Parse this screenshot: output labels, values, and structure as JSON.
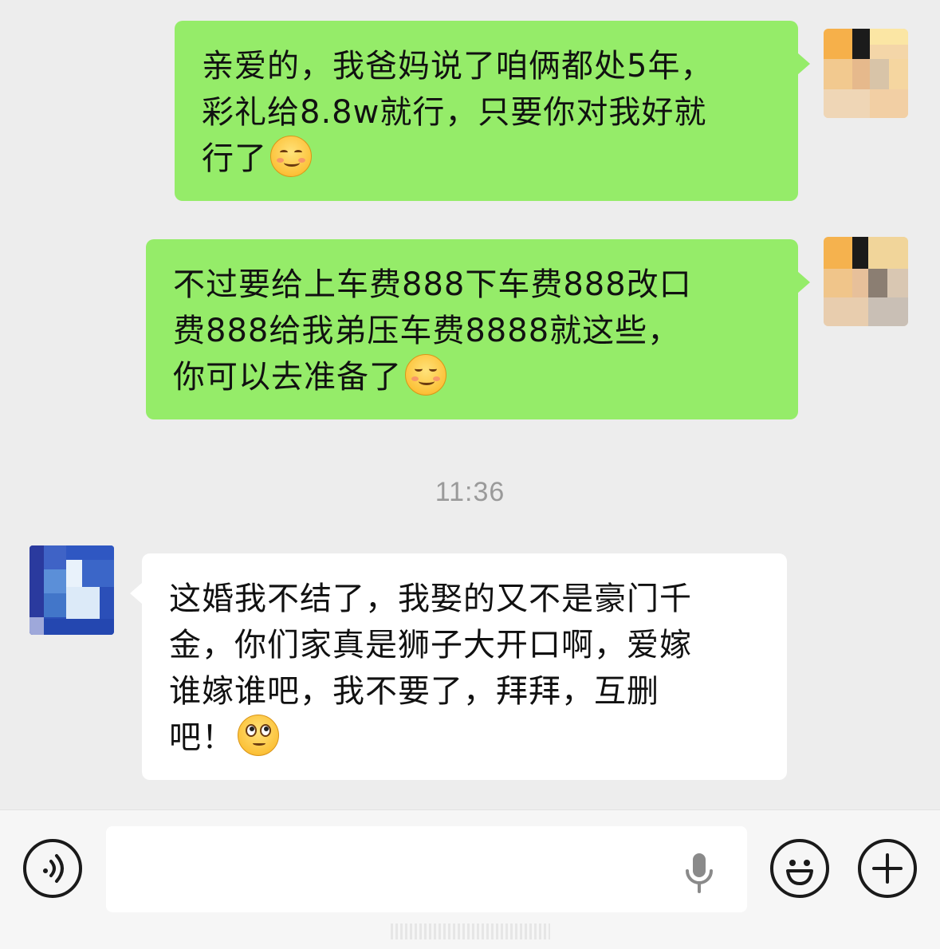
{
  "messages": [
    {
      "side": "right",
      "lines": [
        "亲爱的，我爸妈说了咱俩都处5年，",
        "彩礼给8.8w就行，只要你对我好就",
        "行了"
      ],
      "emoji": "shy-blush-emoji"
    },
    {
      "side": "right",
      "lines": [
        "不过要给上车费888下车费888改口",
        "费888给我弟压车费8888就这些，",
        "你可以去准备了"
      ],
      "emoji": "smile-emoji"
    },
    {
      "side": "left",
      "lines": [
        "这婚我不结了，我娶的又不是豪门千",
        "金，你们家真是狮子大开口啊，爱嫁",
        "谁嫁谁吧，我不要了，拜拜，互删",
        "吧！"
      ],
      "emoji": "eye-roll-emoji"
    }
  ],
  "timestamp": "11:36",
  "toolbar": {
    "voice_icon": "voice-icon",
    "mic_icon": "microphone-icon",
    "emoji_icon": "emoji-icon",
    "plus_icon": "plus-icon"
  },
  "colors": {
    "background": "#ededed",
    "sent_bubble": "#95ec69",
    "received_bubble": "#ffffff",
    "timestamp": "#9a9a9a"
  }
}
